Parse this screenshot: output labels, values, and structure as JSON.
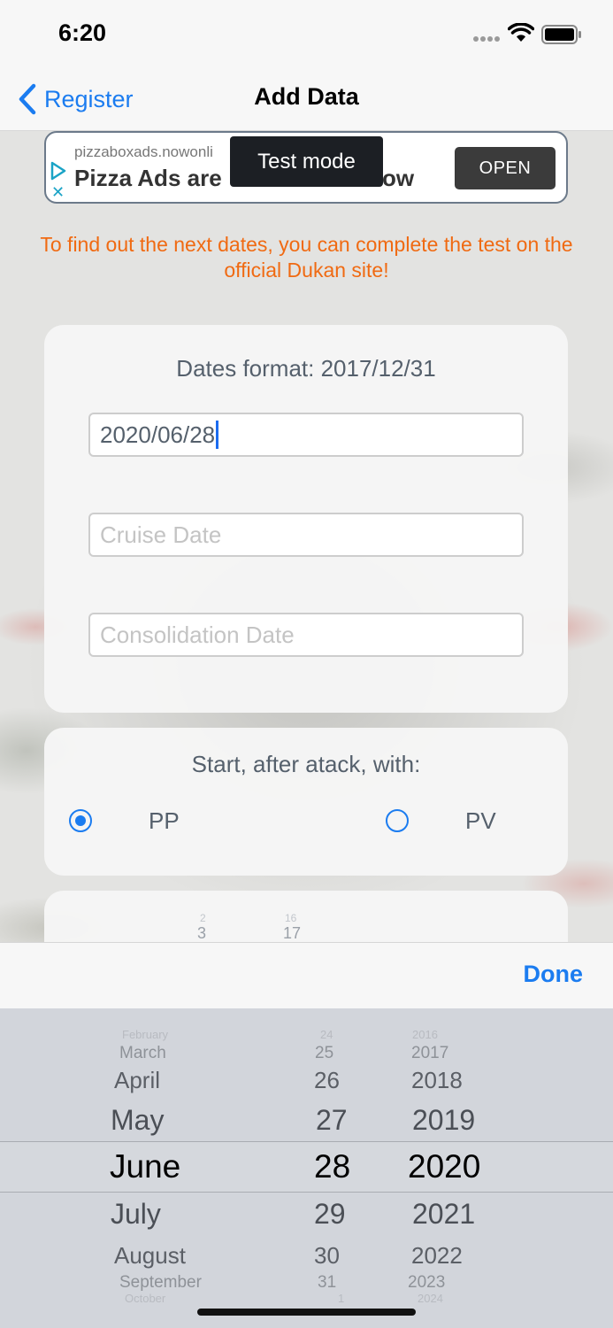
{
  "status_bar": {
    "time": "6:20"
  },
  "nav": {
    "back_label": "Register",
    "title": "Add Data"
  },
  "ad": {
    "domain": "pizzaboxads.nowonli",
    "headline": "Pizza Ads are",
    "headline_tail": "ow",
    "open_label": "OPEN",
    "test_mode_label": "Test mode"
  },
  "notice": "To find out the next dates, you can complete the test on the official Dukan site!",
  "dates_card": {
    "format_label": "Dates format: 2017/12/31",
    "attack_value": "2020/06/28",
    "cruise_placeholder": "Cruise Date",
    "consolidation_placeholder": "Consolidation Date"
  },
  "start_card": {
    "title": "Start, after atack, with:",
    "options": [
      {
        "label": "PP",
        "selected": true
      },
      {
        "label": "PV",
        "selected": false
      }
    ]
  },
  "peek": {
    "a_top": "2",
    "a": "3",
    "b_top": "16",
    "b": "17"
  },
  "toolbar": {
    "done_label": "Done"
  },
  "picker": {
    "months": [
      "February",
      "March",
      "April",
      "May",
      "June",
      "July",
      "August",
      "September",
      "October"
    ],
    "days": [
      "24",
      "25",
      "26",
      "27",
      "28",
      "29",
      "30",
      "31",
      "1"
    ],
    "years": [
      "2016",
      "2017",
      "2018",
      "2019",
      "2020",
      "2021",
      "2022",
      "2023",
      "2024"
    ],
    "selected": {
      "month": "June",
      "day": "28",
      "year": "2020"
    }
  }
}
